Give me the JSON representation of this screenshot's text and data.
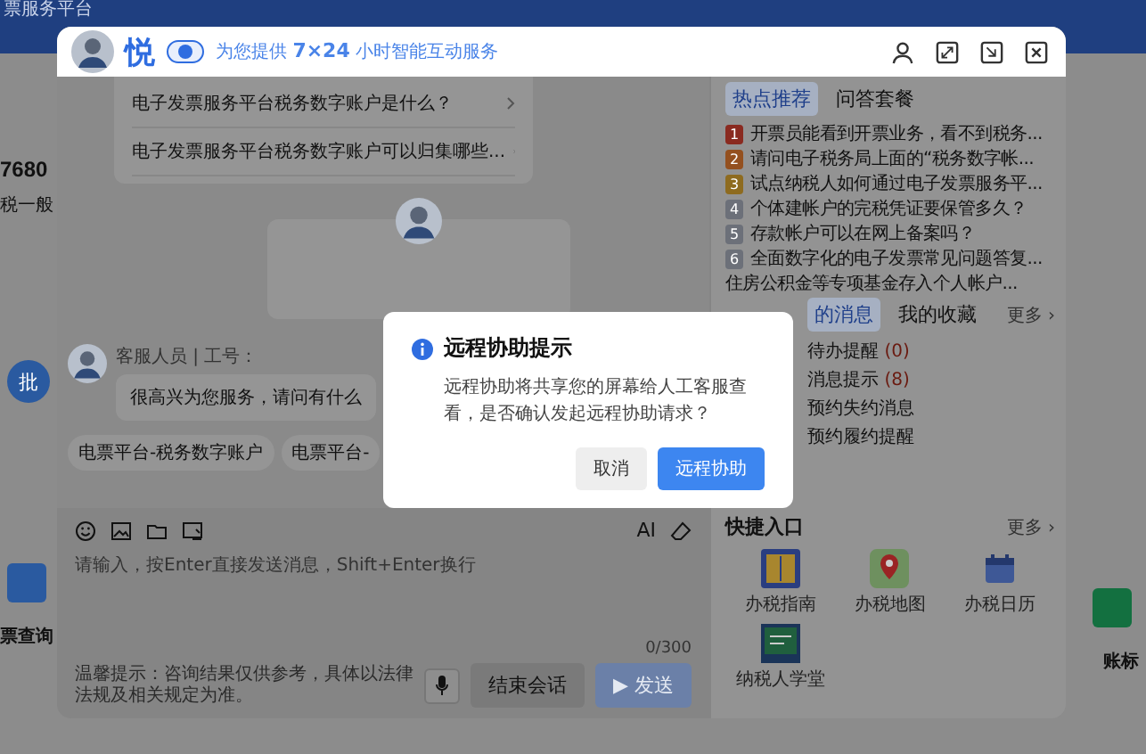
{
  "background_page": {
    "header_title": "票服务平台",
    "left_fragments": [
      {
        "kind": "big",
        "text": "7680"
      },
      {
        "kind": "small",
        "text": "税一般"
      },
      {
        "kind": "circle",
        "text": "批"
      },
      {
        "kind": "square"
      },
      {
        "kind": "bold",
        "text": "票查询"
      }
    ],
    "right_fragments": [
      {
        "kind": "square"
      },
      {
        "kind": "bold",
        "text": "账标"
      }
    ]
  },
  "chat_window": {
    "brand": "悦",
    "slogan": "为您提供 **7×24** 小时智能互动服务",
    "suggestions": [
      "电子发票服务平台税务数字账户是什么？",
      "电子发票服务平台税务数字账户可以归集哪些..."
    ],
    "message": {
      "meta": "客服人员 | 工号：",
      "text": "很高兴为您服务，请问有什么"
    },
    "chips": [
      "电票平台-税务数字账户",
      "电票平台-"
    ],
    "ai_label": "AI",
    "input": {
      "placeholder": "请输入，按Enter直接发送消息，Shift+Enter换行",
      "counter": "0/300"
    },
    "tip": "温馨提示：咨询结果仅供参考，具体以法律法规及相关规定为准。",
    "end_button": "结束会话",
    "send_button": {
      "icon": "▶",
      "label": "发送",
      "disabled": true
    },
    "hot_tabs": [
      {
        "label": "热点推荐",
        "selected": true
      },
      {
        "label": "问答套餐",
        "selected": false
      }
    ],
    "hot_list": [
      {
        "rank": "1",
        "color": "#8a2a20",
        "text": "开票员能看到开票业务，看不到税务..."
      },
      {
        "rank": "2",
        "color": "#94501f",
        "text": "请问电子税务局上面的“税务数字帐..."
      },
      {
        "rank": "3",
        "color": "#8e6b1f",
        "text": "试点纳税人如何通过电子发票服务平..."
      },
      {
        "rank": "4",
        "color": "#6c7079",
        "text": "个体建帐户的完税凭证要保管多久？"
      },
      {
        "rank": "5",
        "color": "#6c7079",
        "text": "存款帐户可以在网上备案吗？"
      },
      {
        "rank": "6",
        "color": "#6c7079",
        "text": "全面数字化的电子发票常见问题答复..."
      },
      {
        "text": "住房公积金等专项基金存入个人帐户..."
      }
    ],
    "msg_tabs": [
      {
        "label": "的消息",
        "selected": true
      },
      {
        "label": "我的收藏",
        "selected": false
      }
    ],
    "msg_more": "更多 ›",
    "messages": [
      {
        "label": "待办提醒",
        "count": "(0)"
      },
      {
        "label": "消息提示",
        "count": "(8)"
      },
      {
        "label": "预约失约消息"
      },
      {
        "label": "预约履约提醒"
      }
    ],
    "quick_title": "快捷入口",
    "quick_more": "更多 ›",
    "quick_items": [
      {
        "kind": "guide",
        "label": "办税指南"
      },
      {
        "kind": "map",
        "label": "办税地图"
      },
      {
        "kind": "calendar",
        "label": "办税日历"
      },
      {
        "kind": "school",
        "label": "纳税人学堂"
      }
    ]
  },
  "dialog": {
    "title": "远程协助提示",
    "body": "远程协助将共享您的屏幕给人工客服查看，是否确认发起远程协助请求？",
    "buttons": [
      {
        "kind": "secondary",
        "label": "取消"
      },
      {
        "kind": "primary",
        "label": "远程协助"
      }
    ]
  }
}
